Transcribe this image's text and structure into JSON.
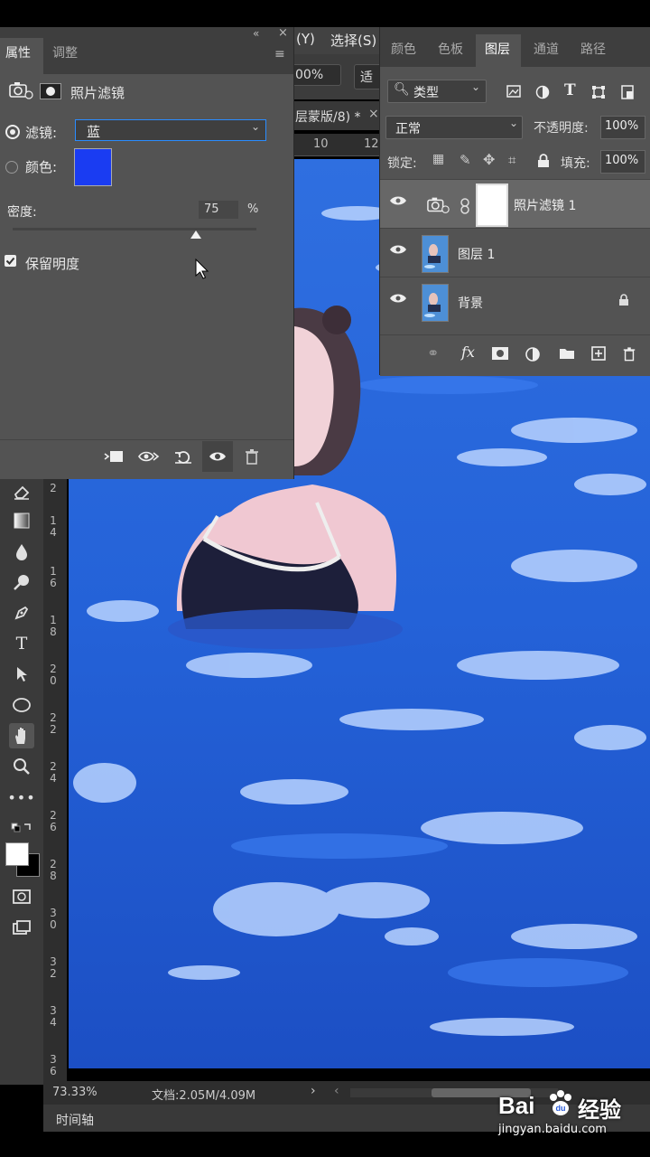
{
  "menu": {
    "item_y": "(Y)",
    "item_select": "选择(S)"
  },
  "options": {
    "percent": "00%",
    "button_fragment": "适"
  },
  "document": {
    "tab_title": "层蒙版/8) *",
    "ruler_top": [
      "10",
      "12"
    ],
    "ruler_left": [
      [
        "2"
      ],
      [
        "1",
        "4"
      ],
      [
        "1",
        "6"
      ],
      [
        "1",
        "8"
      ],
      [
        "2",
        "0"
      ],
      [
        "2",
        "2"
      ],
      [
        "2",
        "4"
      ],
      [
        "2",
        "6"
      ],
      [
        "2",
        "8"
      ],
      [
        "3",
        "0"
      ],
      [
        "3",
        "2"
      ],
      [
        "3",
        "4"
      ],
      [
        "3",
        "6"
      ]
    ]
  },
  "status": {
    "zoom": "73.33%",
    "doc_info": "文档:2.05M/4.09M",
    "timeline_label": "时间轴"
  },
  "properties": {
    "tabs": [
      "属性",
      "调整"
    ],
    "panel_title": "照片滤镜",
    "filter_label": "滤镜:",
    "filter_value": "蓝",
    "color_label": "颜色:",
    "color_swatch": "#1a3cf2",
    "density_label": "密度:",
    "density_value": "75",
    "density_unit": "%",
    "density_level": 0.75,
    "preserve_label": "保留明度",
    "preserve_checked": true
  },
  "layers_panel": {
    "tabs": [
      "颜色",
      "色板",
      "图层",
      "通道",
      "路径"
    ],
    "active_tab": "图层",
    "filter_type": "类型",
    "blend_mode": "正常",
    "opacity_label": "不透明度:",
    "opacity_value": "100%",
    "lock_label": "锁定:",
    "fill_label": "填充:",
    "fill_value": "100%",
    "layers": [
      {
        "name": "照片滤镜 1",
        "kind": "adjustment"
      },
      {
        "name": "图层 1",
        "kind": "image"
      },
      {
        "name": "背景",
        "kind": "background",
        "locked": true
      }
    ],
    "footer_icons": [
      "link-icon",
      "fx-icon",
      "mask-icon",
      "adjustment-icon",
      "folder-icon",
      "new-layer-icon",
      "trash-icon"
    ]
  },
  "watermark": {
    "brand": "Bai",
    "brand2": "经验",
    "url": "jingyan.baidu.com"
  },
  "colors": {
    "panel_bg": "#535353",
    "dark_bg": "#3e3e3e",
    "accent_blue": "#1a3cf2"
  }
}
